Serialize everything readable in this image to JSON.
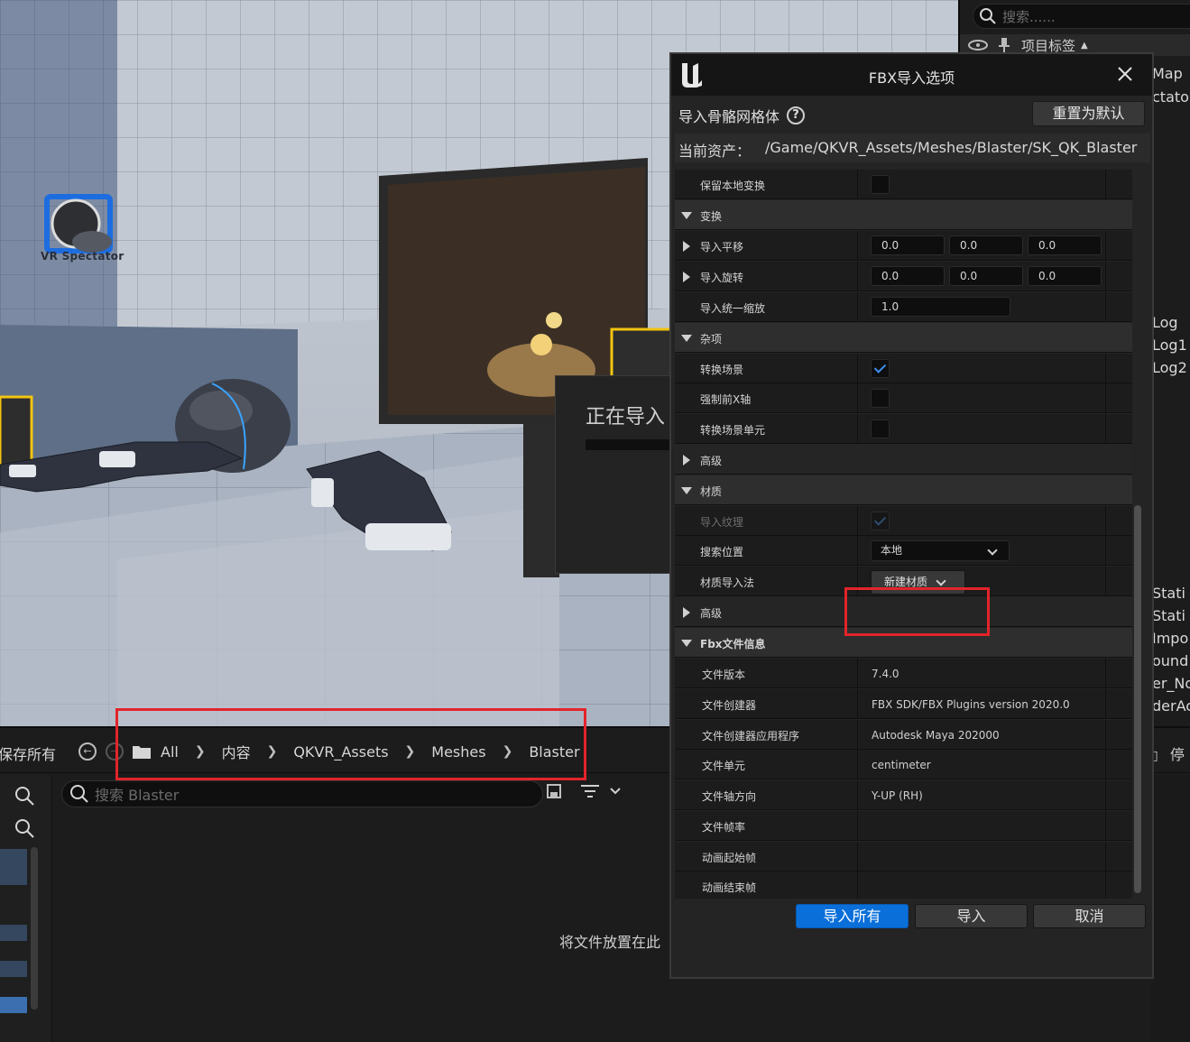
{
  "viewport": {
    "spectator_label": "VR Spectator",
    "importing_text": "正在导入"
  },
  "outliner": {
    "search_placeholder": "搜索......",
    "header_label": "项目标签",
    "items": [
      "Map",
      "ctato",
      "Log",
      "Log1",
      "Log2",
      "Stati",
      "Stati",
      "Impo",
      "ound",
      "er_No",
      "derAc"
    ]
  },
  "content_browser": {
    "save_all": "保存所有",
    "breadcrumb": [
      "All",
      "内容",
      "QKVR_Assets",
      "Meshes",
      "Blaster"
    ],
    "search_placeholder": "搜索 Blaster",
    "drop_hint": "将文件放置在此",
    "right_button": "停"
  },
  "dialog": {
    "title": "FBX导入选项",
    "subheader": "导入骨骼网格体",
    "reset_button": "重置为默认",
    "asset_label": "当前资产：",
    "asset_path": "/Game/QKVR_Assets/Meshes/Blaster/SK_QK_Blaster",
    "rows": {
      "keep_local": "保留本地变换",
      "transform": "变换",
      "import_translation": "导入平移",
      "import_rotation": "导入旋转",
      "uniform_scale": "导入统一缩放",
      "misc": "杂项",
      "convert_scene": "转换场景",
      "force_front_x": "强制前X轴",
      "convert_scene_unit": "转换场景单元",
      "advanced1": "高级",
      "material": "材质",
      "import_textures": "导入纹理",
      "search_location": "搜索位置",
      "material_import_method": "材质导入法",
      "advanced2": "高级",
      "fbx_info": "Fbx文件信息",
      "file_version": "文件版本",
      "file_creator": "文件创建器",
      "file_creator_app": "文件创建器应用程序",
      "file_units": "文件单元",
      "file_axis": "文件轴方向",
      "file_framerate": "文件帧率",
      "anim_start": "动画起始帧",
      "anim_end": "动画结束帧"
    },
    "values": {
      "translation": [
        "0.0",
        "0.0",
        "0.0"
      ],
      "rotation": [
        "0.0",
        "0.0",
        "0.0"
      ],
      "scale": "1.0",
      "search_location": "本地",
      "material_import_method": "新建材质",
      "file_version": "7.4.0",
      "file_creator": "FBX SDK/FBX Plugins version 2020.0",
      "file_creator_app": "Autodesk Maya 202000",
      "file_units": "centimeter",
      "file_axis": "Y-UP (RH)"
    },
    "buttons": {
      "import_all": "导入所有",
      "import": "导入",
      "cancel": "取消"
    }
  },
  "colors": {
    "accent": "#0a6fd9",
    "checkbox": "#3d8fe8",
    "highlight": "#e3242b"
  }
}
